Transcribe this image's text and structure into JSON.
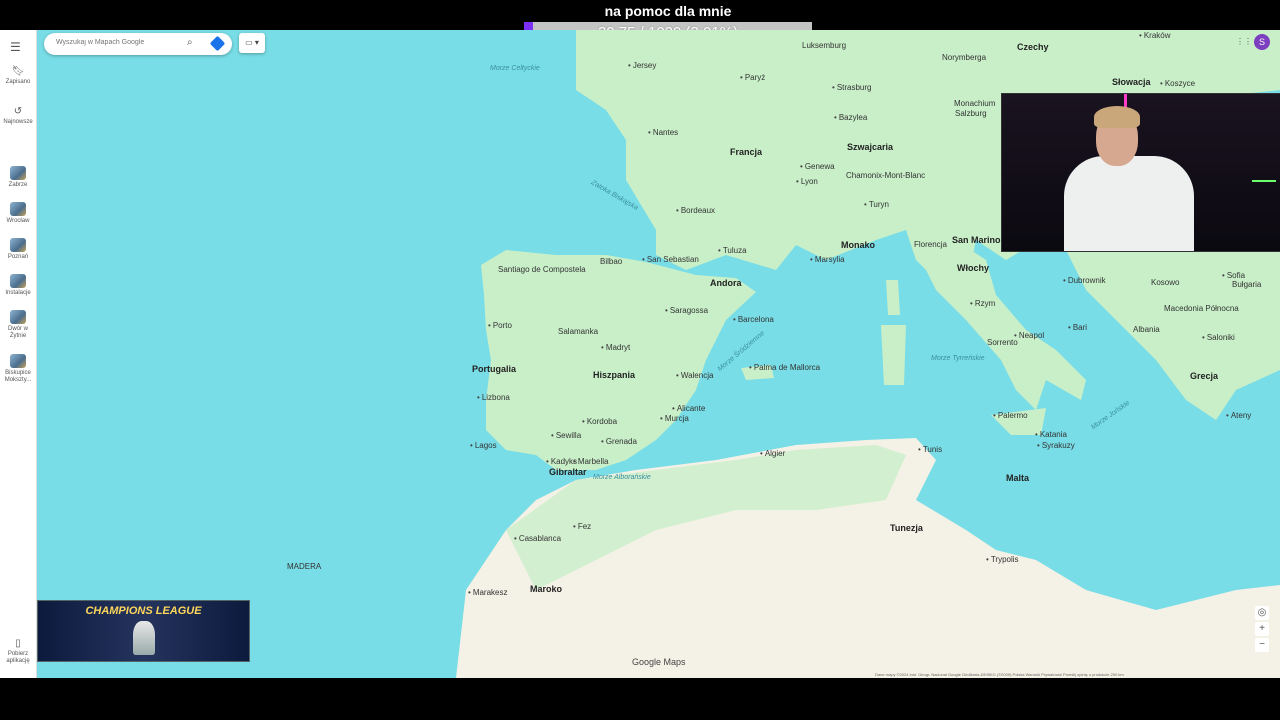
{
  "overlay": {
    "title": "na pomoc dla mnie",
    "progress_text": "30.75 / 1020 (3.01%)",
    "progress_fraction": 0.0301,
    "accent": "#7b2ff7"
  },
  "search": {
    "placeholder": "Wyszukaj w Mapach Google"
  },
  "sidebar": {
    "items": [
      {
        "label": "Zapisano",
        "icon": "bookmark-icon"
      },
      {
        "label": "Najnowsze",
        "icon": "history-icon"
      },
      {
        "label": "Zabrze",
        "icon": "place-thumb"
      },
      {
        "label": "Wrocław",
        "icon": "place-thumb"
      },
      {
        "label": "Poznań",
        "icon": "place-thumb"
      },
      {
        "label": "Instalacje",
        "icon": "place-thumb"
      },
      {
        "label": "Dwór w Żytnie",
        "icon": "place-thumb"
      },
      {
        "label": "Biskupice Mokszty...",
        "icon": "place-thumb"
      },
      {
        "label": "Pobierz aplikację",
        "icon": "phone-icon"
      }
    ]
  },
  "map": {
    "countries": [
      "Francja",
      "Hiszpania",
      "Portugalia",
      "Andora",
      "Szwajcaria",
      "Włochy",
      "Monako",
      "San Marino",
      "Maroko",
      "Tunezja",
      "Malta",
      "Grecja",
      "Czechy",
      "Słowacja",
      "Albania",
      "Bułgaria",
      "Kosowo",
      "Macedonia Północna",
      "Luksemburg",
      "MADERA"
    ],
    "cities": [
      "Jersey",
      "Paryż",
      "Nantes",
      "Bordeaux",
      "Lyon",
      "Genewa",
      "Turyn",
      "Marsylia",
      "Bilbao",
      "San Sebastian",
      "Tuluza",
      "Barcelona",
      "Saragossa",
      "Porto",
      "Madryt",
      "Walencja",
      "Lizbona",
      "Sewilla",
      "Kordoba",
      "Grenada",
      "Murcja",
      "Alicante",
      "Palma de Mallorca",
      "Gibraltar",
      "Fez",
      "Casablanca",
      "Marakesz",
      "Algier",
      "Tunis",
      "Trypolis",
      "Neapol",
      "Rzym",
      "Florencja",
      "Palermo",
      "Katania",
      "Syrakuzy",
      "Sorrento",
      "Bari",
      "Ateny",
      "Saloniki",
      "Sofia",
      "Dubrownik",
      "Strasburg",
      "Norymberga",
      "Monachium",
      "Salzburg",
      "Kraków",
      "Koszyce",
      "Kordoba",
      "Santiago de Compostela",
      "Salamanka",
      "Lagos",
      "Kadyks",
      "Marbella",
      "Walencja",
      "Bazylea",
      "Chamonix-Mont-Blanc"
    ],
    "seas": [
      "Zatoka Biskajska",
      "Morze Śródziemne",
      "Morze Alborańskie",
      "Morze Jońskie",
      "Morze Tyrreńskie",
      "Morze Celtyckie"
    ],
    "logo": "Google Maps",
    "attribution": "Dane mapy ©2024 Inst. Geogr. Nacional Google GeoBasis-DE/BKG (©2009)  Polska  Warunki  Prywatność  Prześlij opinię o produkcie  200 km"
  },
  "banner": {
    "title": "CHAMPIONS LEAGUE"
  },
  "profile": {
    "initial": "S"
  },
  "colors": {
    "water": "#78dde6",
    "land": "#c9efc9",
    "desert": "#f4f1e6"
  }
}
